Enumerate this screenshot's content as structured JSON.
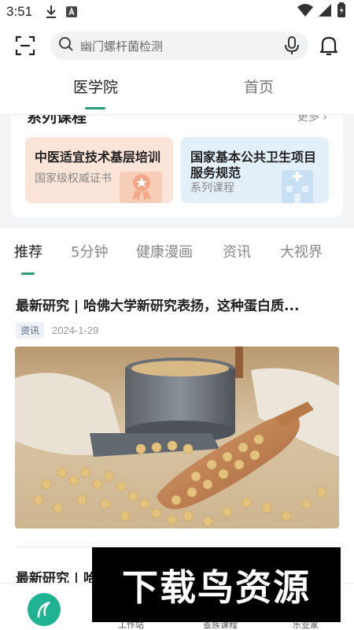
{
  "status_bar": {
    "time": "3:51",
    "icons": [
      "download-icon",
      "a-box-icon",
      "wifi-icon",
      "signal-icon",
      "battery-icon"
    ]
  },
  "header": {
    "search_placeholder": "幽门螺杆菌检测",
    "icons": [
      "scan-icon",
      "search-icon",
      "mic-icon",
      "bell-icon"
    ]
  },
  "top_tabs": [
    {
      "label": "医学院",
      "active": true
    },
    {
      "label": "首页",
      "active": false
    }
  ],
  "courses": {
    "section_title": "系列课程",
    "more_label": "更多 ›",
    "items": [
      {
        "title": "中医适宜技术基层培训",
        "subtitle": "国家级权威证书"
      },
      {
        "title": "国家基本公共卫生项目服务规范",
        "subtitle": "系列课程"
      }
    ]
  },
  "category_tabs": [
    {
      "label": "推荐",
      "active": true
    },
    {
      "label": "5分钟",
      "active": false
    },
    {
      "label": "健康漫画",
      "active": false
    },
    {
      "label": "资讯",
      "active": false
    },
    {
      "label": "大视界",
      "active": false
    }
  ],
  "article": {
    "title": "最新研究 | 哈佛大学新研究表扬，这种蛋白质...",
    "tag": "资讯",
    "date": "2024-1-29"
  },
  "article2": {
    "title": "最新研究 | 哈"
  },
  "bottom_nav": {
    "labels": [
      "工作站",
      "查族课程",
      "乐业家"
    ]
  },
  "watermark": "下载鸟资源",
  "colors": {
    "accent": "#2a9d7a",
    "logo": "#1fb394",
    "card_orange": "#fbe4d8",
    "card_blue": "#e3f0fa"
  }
}
